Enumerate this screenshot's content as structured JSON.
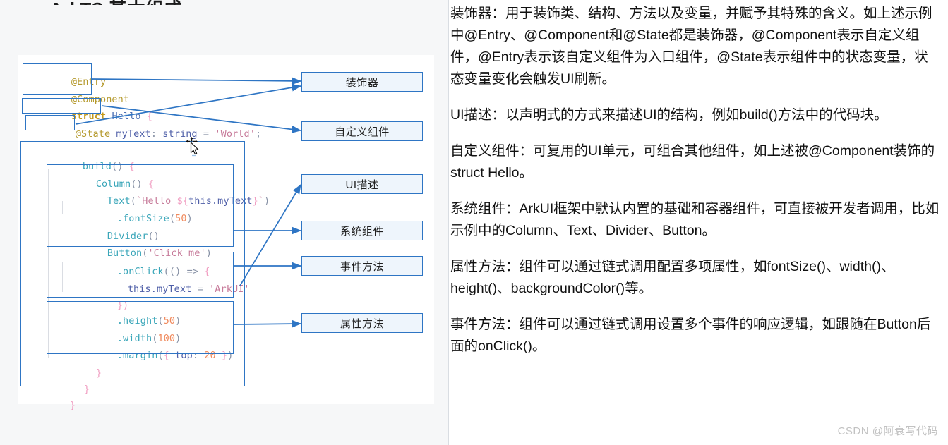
{
  "title_partial": "ArkTS 基本组成",
  "left_panel": {
    "code_lines": [
      {
        "id": "entry",
        "text": "@Entry"
      },
      {
        "id": "component",
        "text": "@Component"
      },
      {
        "id": "struct",
        "text": "struct Hello {"
      },
      {
        "id": "state",
        "text": "  @State myText: string = 'World';"
      },
      {
        "id": "build",
        "text": "  build() {"
      },
      {
        "id": "column",
        "text": "    Column() {"
      },
      {
        "id": "text",
        "text": "      Text(`Hello ${this.myText}`)"
      },
      {
        "id": "fontsize",
        "text": "        .fontSize(50)"
      },
      {
        "id": "divider",
        "text": "      Divider()"
      },
      {
        "id": "button",
        "text": "      Button('Click me')"
      },
      {
        "id": "onclick",
        "text": "        .onClick(() => {"
      },
      {
        "id": "assign",
        "text": "          this.myText = 'ArkUI'"
      },
      {
        "id": "closefn",
        "text": "        })"
      },
      {
        "id": "height",
        "text": "        .height(50)"
      },
      {
        "id": "width",
        "text": "        .width(100)"
      },
      {
        "id": "margin",
        "text": "        .margin({ top: 20 })"
      },
      {
        "id": "closecol",
        "text": "      }"
      },
      {
        "id": "closebuild",
        "text": "    }"
      },
      {
        "id": "closestruct",
        "text": "  }"
      }
    ],
    "labels": [
      {
        "id": "decorator",
        "text": "装饰器"
      },
      {
        "id": "custom-component",
        "text": "自定义组件"
      },
      {
        "id": "ui-description",
        "text": "UI描述"
      },
      {
        "id": "system-component",
        "text": "系统组件"
      },
      {
        "id": "event-method",
        "text": "事件方法"
      },
      {
        "id": "attribute-method",
        "text": "属性方法"
      }
    ]
  },
  "right_panel": {
    "paragraphs": [
      "装饰器：用于装饰类、结构、方法以及变量，并赋予其特殊的含义。如上述示例中@Entry、@Component和@State都是装饰器，@Component表示自定义组件，@Entry表示该自定义组件为入口组件，@State表示组件中的状态变量，状态变量变化会触发UI刷新。",
      "UI描述：以声明式的方式来描述UI的结构，例如build()方法中的代码块。",
      "自定义组件：可复用的UI单元，可组合其他组件，如上述被@Component装饰的struct Hello。",
      "系统组件：ArkUI框架中默认内置的基础和容器组件，可直接被开发者调用，比如示例中的Column、Text、Divider、Button。",
      "属性方法：组件可以通过链式调用配置多项属性，如fontSize()、width()、height()、backgroundColor()等。",
      "事件方法：组件可以通过链式调用设置多个事件的响应逻辑，如跟随在Button后面的onClick()。"
    ]
  },
  "watermark": "CSDN @阿衰写代码",
  "colors": {
    "accent_blue": "#2e75c4",
    "box_fill": "#eef5fc",
    "panel_bg": "#f6f7f8",
    "text_bg": "#ffffff",
    "watermark": "#c2c2c2"
  }
}
